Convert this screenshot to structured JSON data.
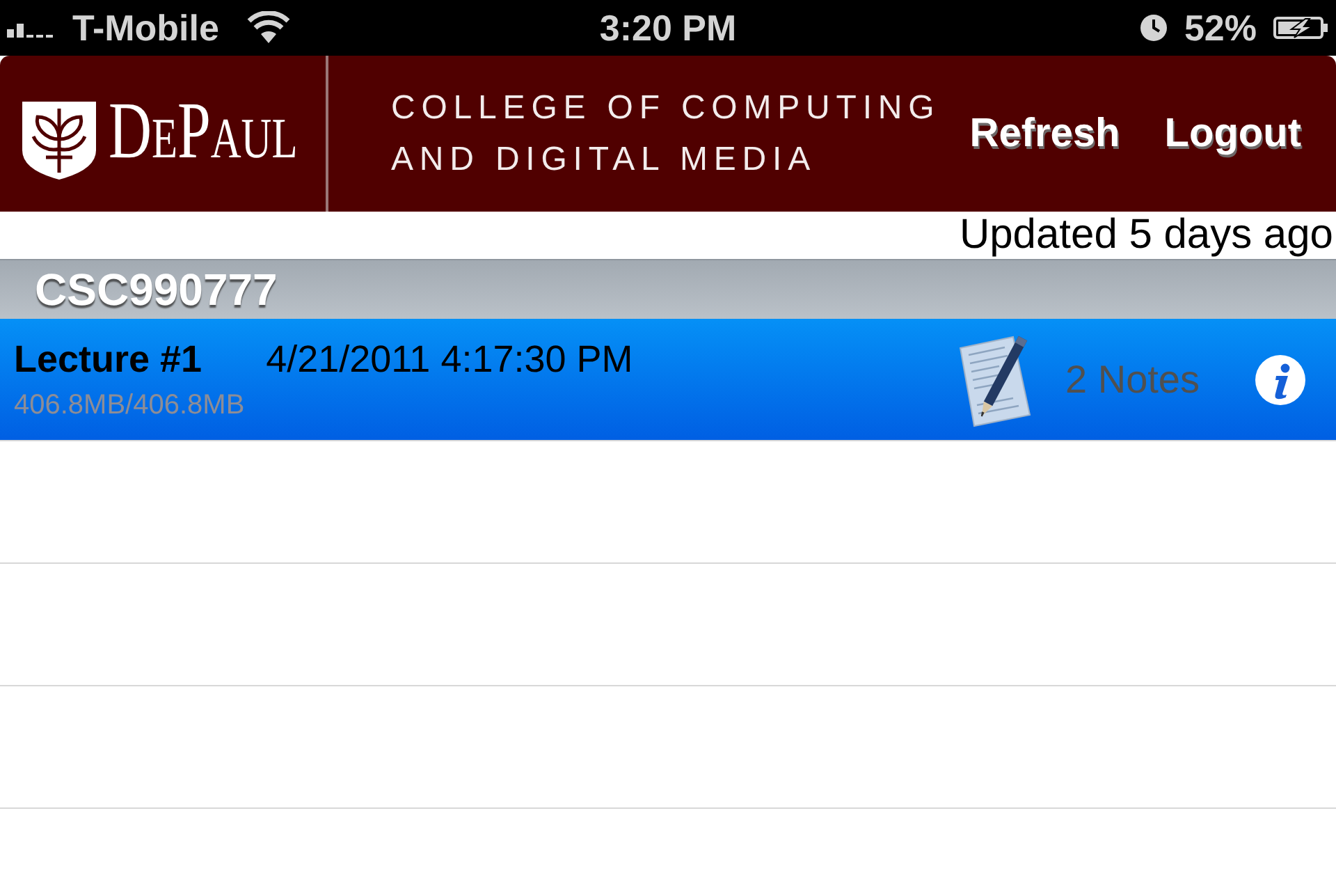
{
  "status_bar": {
    "carrier": "T-Mobile",
    "time": "3:20 PM",
    "battery": "52%"
  },
  "header": {
    "logo": "DePaul",
    "college": [
      "COLLEGE OF COMPUTING",
      "AND DIGITAL MEDIA"
    ],
    "actions": [
      "Refresh",
      "Logout"
    ]
  },
  "updated": "Updated 5 days ago",
  "sections": [
    {
      "title": "CSC990777",
      "rows": [
        {
          "title": "Lecture #1",
          "date": "4/21/2011 4:17:30 PM",
          "size": "406.8MB/406.8MB",
          "notes": "2 Notes",
          "selected": true
        }
      ]
    }
  ]
}
